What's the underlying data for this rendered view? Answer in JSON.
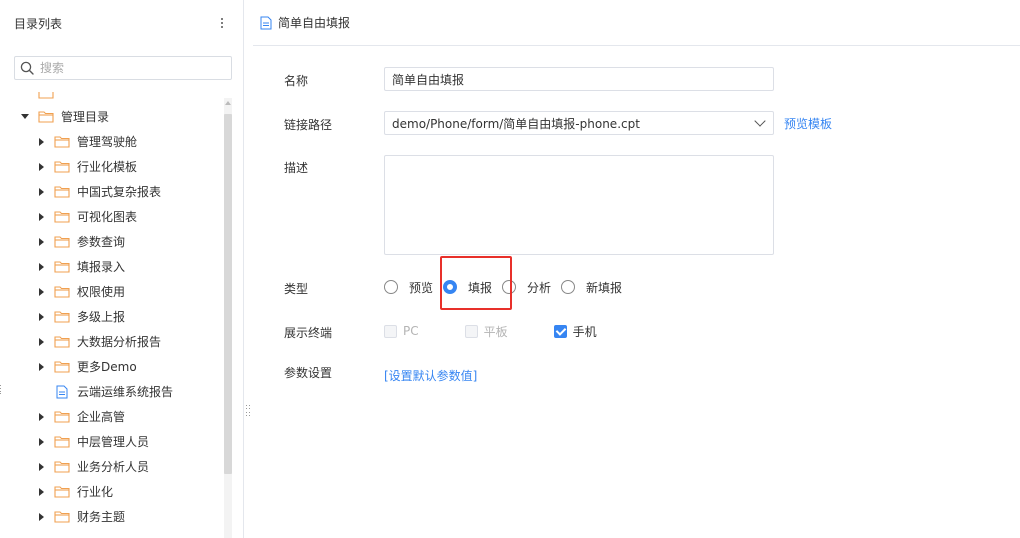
{
  "sidebar": {
    "title": "目录列表",
    "search": {
      "placeholder": "搜索",
      "value": ""
    },
    "tree": [
      {
        "label": "管理目录",
        "type": "folder",
        "expanded": true,
        "level": 0
      },
      {
        "label": "管理驾驶舱",
        "type": "folder",
        "expanded": false,
        "level": 1
      },
      {
        "label": "行业化模板",
        "type": "folder",
        "expanded": false,
        "level": 1
      },
      {
        "label": "中国式复杂报表",
        "type": "folder",
        "expanded": false,
        "level": 1
      },
      {
        "label": "可视化图表",
        "type": "folder",
        "expanded": false,
        "level": 1
      },
      {
        "label": "参数查询",
        "type": "folder",
        "expanded": false,
        "level": 1
      },
      {
        "label": "填报录入",
        "type": "folder",
        "expanded": false,
        "level": 1
      },
      {
        "label": "权限使用",
        "type": "folder",
        "expanded": false,
        "level": 1
      },
      {
        "label": "多级上报",
        "type": "folder",
        "expanded": false,
        "level": 1
      },
      {
        "label": "大数据分析报告",
        "type": "folder",
        "expanded": false,
        "level": 1
      },
      {
        "label": "更多Demo",
        "type": "folder",
        "expanded": false,
        "level": 1
      },
      {
        "label": "云端运维系统报告",
        "type": "file",
        "level": 1
      },
      {
        "label": "企业高管",
        "type": "folder",
        "expanded": false,
        "level": 1
      },
      {
        "label": "中层管理人员",
        "type": "folder",
        "expanded": false,
        "level": 1
      },
      {
        "label": "业务分析人员",
        "type": "folder",
        "expanded": false,
        "level": 1
      },
      {
        "label": "行业化",
        "type": "folder",
        "expanded": false,
        "level": 1
      },
      {
        "label": "财务主题",
        "type": "folder",
        "expanded": false,
        "level": 1
      }
    ]
  },
  "main": {
    "title": "简单自由填报",
    "form": {
      "name_label": "名称",
      "name_value": "简单自由填报",
      "path_label": "链接路径",
      "path_value": "demo/Phone/form/简单自由填报-phone.cpt",
      "preview_template": "预览模板",
      "desc_label": "描述",
      "desc_value": "",
      "type_label": "类型",
      "type_options": [
        {
          "label": "预览",
          "checked": false
        },
        {
          "label": "填报",
          "checked": true
        },
        {
          "label": "分析",
          "checked": false
        },
        {
          "label": "新填报",
          "checked": false
        }
      ],
      "terminal_label": "展示终端",
      "terminal_options": [
        {
          "label": "PC",
          "checked": false,
          "disabled": true
        },
        {
          "label": "平板",
          "checked": false,
          "disabled": true
        },
        {
          "label": "手机",
          "checked": true,
          "disabled": false
        }
      ],
      "param_label": "参数设置",
      "param_link": "[设置默认参数值]"
    }
  },
  "colors": {
    "accent": "#3685f2",
    "folder": "#f0a050",
    "highlight": "#e8302a"
  }
}
